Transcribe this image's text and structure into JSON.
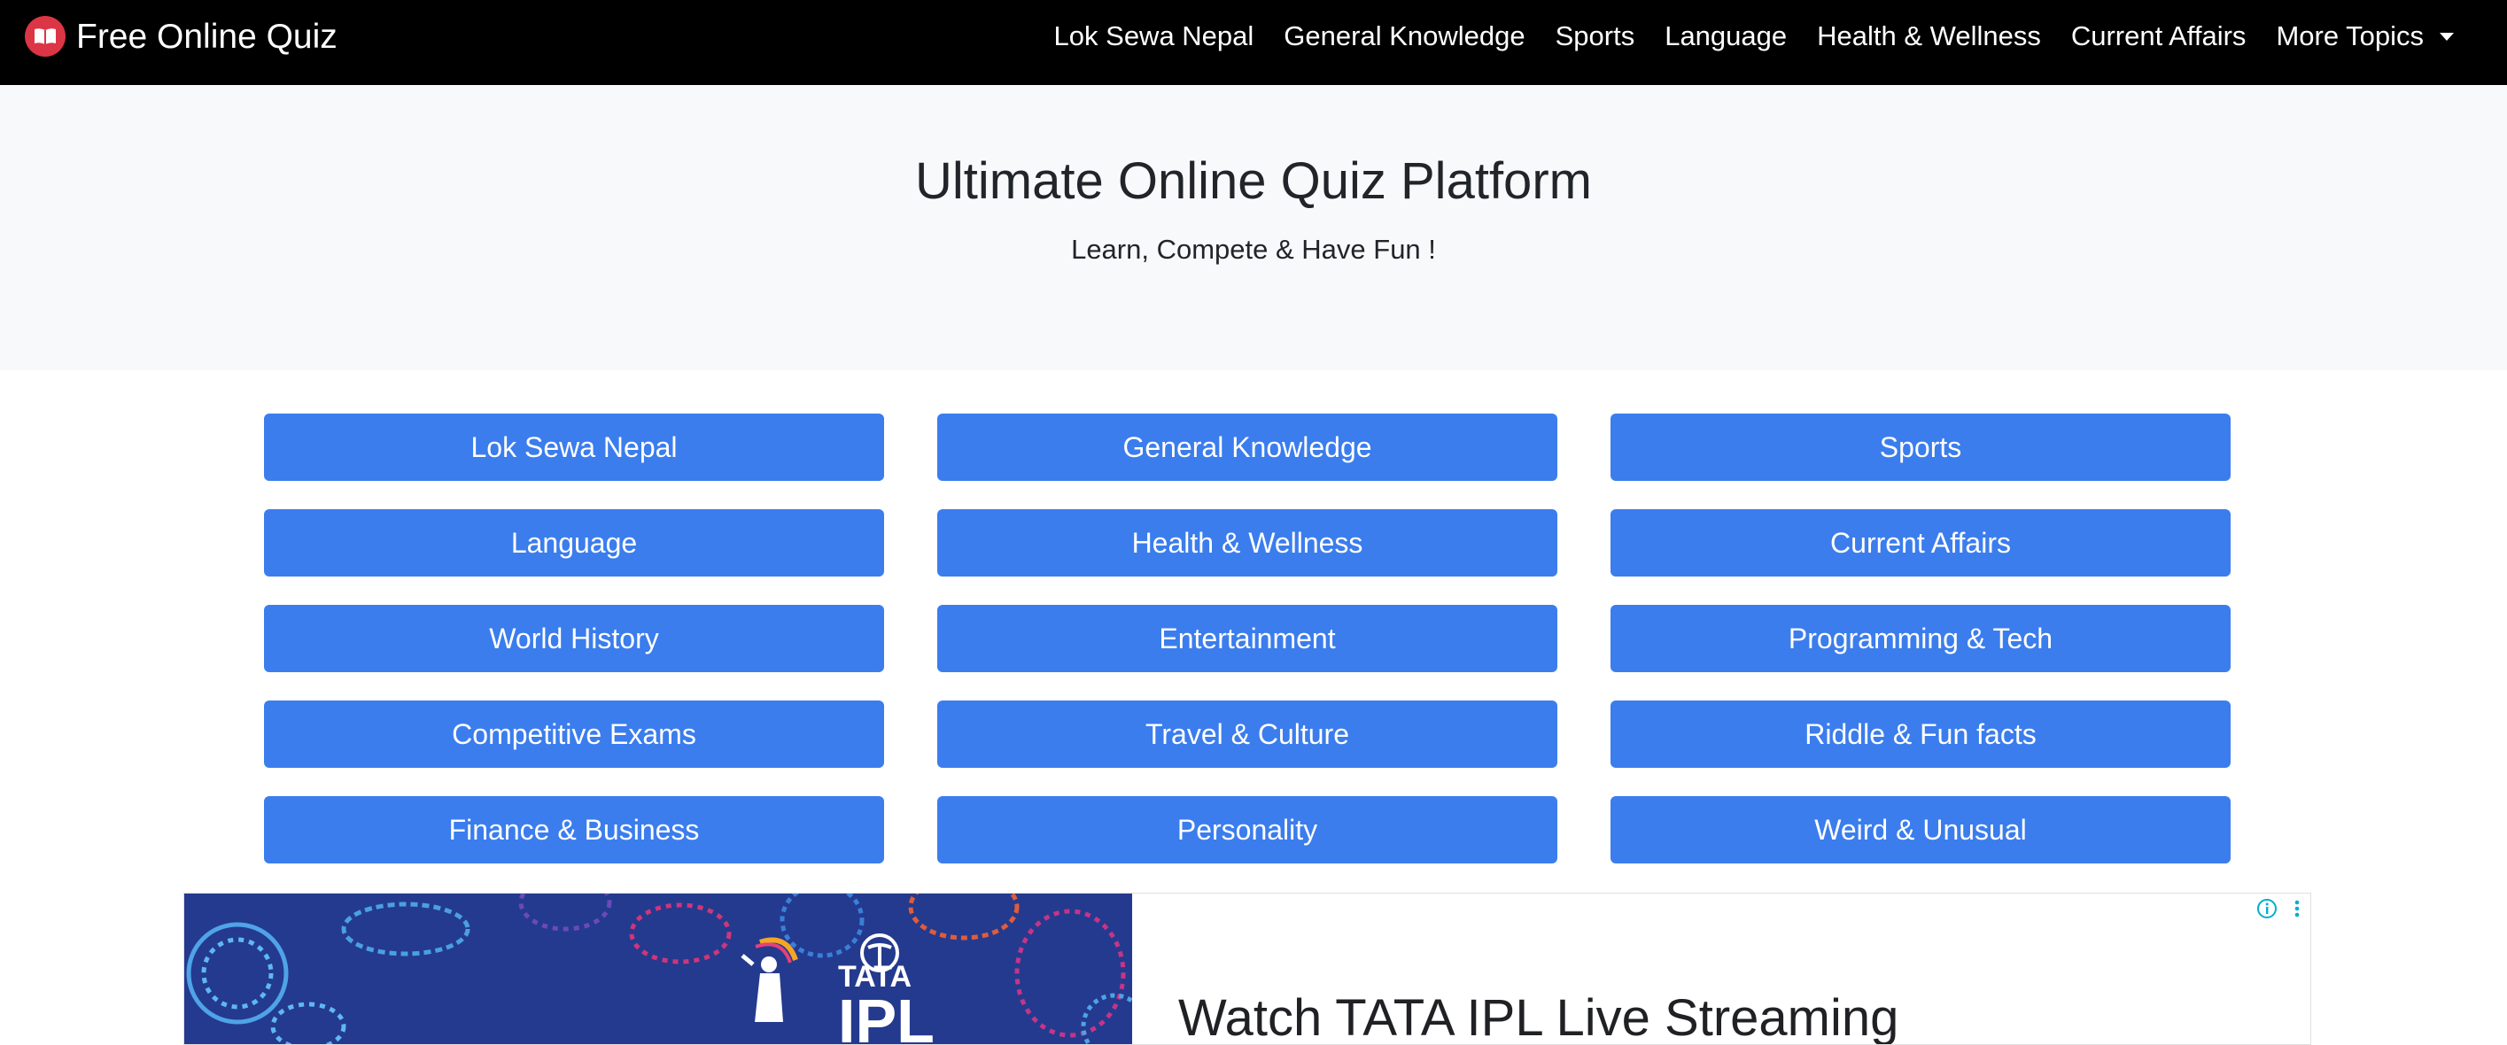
{
  "navbar": {
    "brand": "Free Online Quiz",
    "brand_icon": "book-icon",
    "links": [
      "Lok Sewa Nepal",
      "General Knowledge",
      "Sports",
      "Language",
      "Health & Wellness",
      "Current Affairs"
    ],
    "more_label": "More Topics",
    "more_icon": "caret-down-icon"
  },
  "hero": {
    "title": "Ultimate Online Quiz Platform",
    "subtitle": "Learn, Compete & Have Fun !"
  },
  "categories": [
    "Lok Sewa Nepal",
    "General Knowledge",
    "Sports",
    "Language",
    "Health & Wellness",
    "Current Affairs",
    "World History",
    "Entertainment",
    "Programming & Tech",
    "Competitive Exams",
    "Travel & Culture",
    "Riddle & Fun facts",
    "Finance & Business",
    "Personality",
    "Weird & Unusual"
  ],
  "ad": {
    "headline": "Watch TATA IPL Live Streaming",
    "logo_text": "TATA IPL",
    "info_icon": "info-icon",
    "menu_icon": "kebab-menu-icon"
  },
  "colors": {
    "navbar_bg": "#000000",
    "hero_bg": "#f8f9fa",
    "button_bg": "#3b7ded",
    "brand_icon_bg": "#dc3545",
    "ad_image_bg": "#243a8e"
  }
}
